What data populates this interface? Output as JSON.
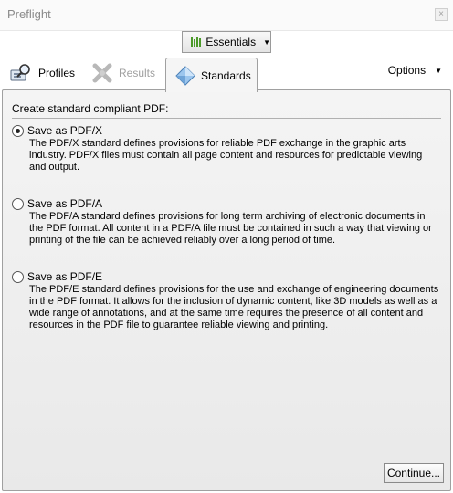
{
  "window": {
    "title": "Preflight"
  },
  "toolbar": {
    "essentials_label": "Essentials"
  },
  "tabs": {
    "profiles": "Profiles",
    "results": "Results",
    "standards": "Standards",
    "options": "Options"
  },
  "standards_panel": {
    "heading": "Create standard compliant PDF:",
    "options": [
      {
        "label": "Save as PDF/X",
        "selected": true,
        "description": "The PDF/X standard defines provisions for reliable PDF exchange in the graphic arts industry. PDF/X files must contain all page content and resources for predictable viewing and output."
      },
      {
        "label": "Save as PDF/A",
        "selected": false,
        "description": "The PDF/A standard defines provisions for long term archiving of electronic documents in the PDF format. All content in a PDF/A file must be contained in such a way that viewing or printing of the file can be achieved reliably over a long period of time."
      },
      {
        "label": "Save as PDF/E",
        "selected": false,
        "description": "The PDF/E standard defines provisions for the use and exchange of engineering documents in the PDF format. It allows for the inclusion of dynamic content, like 3D models as well as a wide range of annotations, and at the same time requires the presence of all content and resources in the PDF file to guarantee reliable viewing and printing."
      }
    ],
    "continue_label": "Continue..."
  },
  "colors": {
    "accent_green": "#4c9a2a",
    "panel_bg": "#eeeeee",
    "disabled_text": "#a0a0a0"
  }
}
